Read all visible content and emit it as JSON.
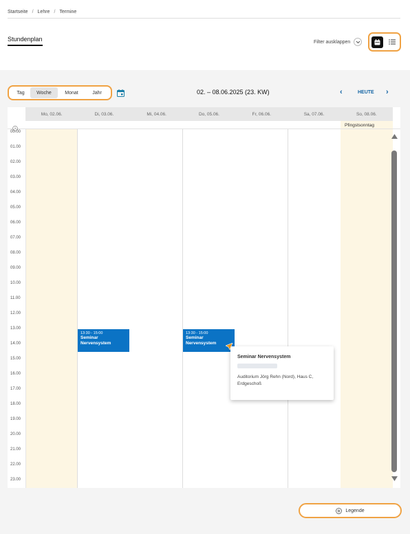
{
  "breadcrumb": [
    "Startseite",
    "Lehre",
    "Termine"
  ],
  "breadcrumb_sep": "/",
  "page_title": "Stundenplan",
  "filter": {
    "label": "Filter ausklappen"
  },
  "view_toggle": {
    "calendar": "calendar-icon",
    "list": "list-icon"
  },
  "range_tabs": [
    "Tag",
    "Woche",
    "Monat",
    "Jahr"
  ],
  "active_tab": "Woche",
  "week_label": "02. – 08.06.2025 (23. KW)",
  "nav": {
    "prev": "‹",
    "today": "HEUTE",
    "next": "›"
  },
  "days": [
    "Mo, 02.06.",
    "Di, 03.06.",
    "Mi, 04.06.",
    "Do, 05.06.",
    "Fr, 06.06.",
    "Sa, 07.06.",
    "So, 08.06."
  ],
  "holiday": "Pfingstsonntag",
  "hours": [
    "00.00",
    "01.00",
    "02.00",
    "03.00",
    "04.00",
    "05.00",
    "06.00",
    "07.00",
    "08.00",
    "09.00",
    "10.00",
    "11.00",
    "12.00",
    "13.00",
    "14.00",
    "15.00",
    "16.00",
    "17.00",
    "18.00",
    "19.00",
    "20.00",
    "21.00",
    "22.00",
    "23.00"
  ],
  "events": [
    {
      "day": "Di, 03.06.",
      "time": "13:30 - 15:00",
      "title": "Seminar Nervensystem"
    },
    {
      "day": "Do, 05.06.",
      "time": "13:30 - 15:00",
      "title": "Seminar Nervensystem"
    }
  ],
  "popup": {
    "title": "Seminar Nervensystem",
    "location": "Auditorium Jörg Rehn (Nord), Haus C, Erdgeschoß"
  },
  "legend": {
    "label": "Legende"
  },
  "colors": {
    "accent_outline": "#f0a243",
    "event": "#0b73c5",
    "nav": "#1565a5",
    "holiday_bg": "#fdf6e3"
  }
}
